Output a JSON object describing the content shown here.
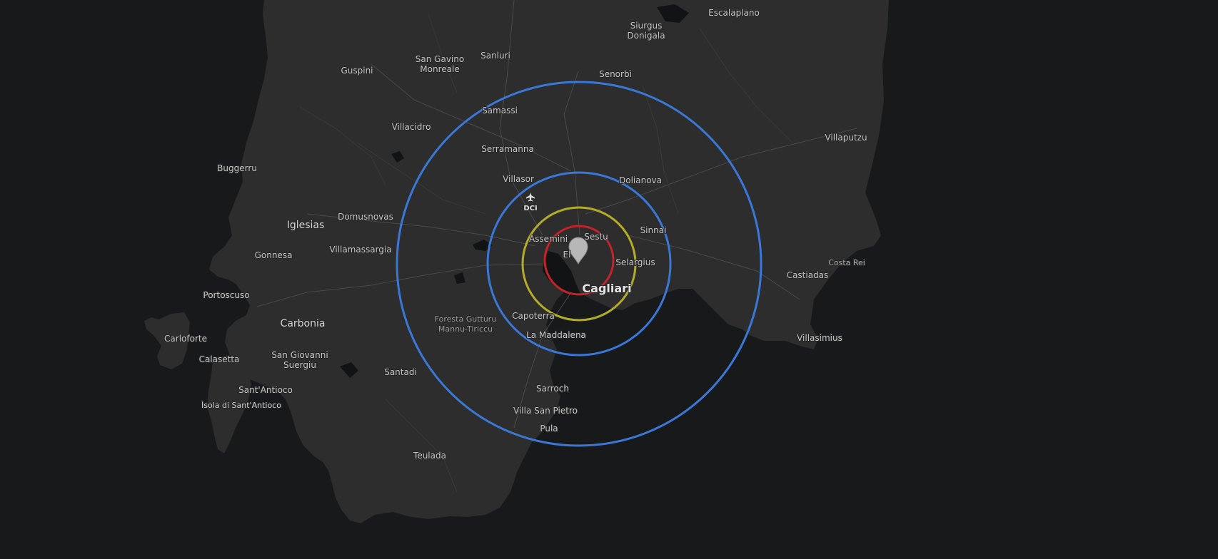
{
  "map": {
    "colors": {
      "background": "#17191a",
      "land": "#2d2d2d",
      "ring_blue": "#3a78d8",
      "ring_yellow": "#b3ad26",
      "ring_red": "#c42328",
      "marker": "#b7b7b7"
    },
    "marker_icon": "map-pin-icon",
    "airport_icon": "airplane-icon",
    "airport_code": "DCI",
    "labels": {
      "escalaplano": "Escalaplano",
      "siurgus_1": "Siurgus",
      "siurgus_2": "Donigala",
      "sangavino_1": "San Gavino",
      "sangavino_2": "Monreale",
      "sanluri": "Sanluri",
      "guspini": "Guspini",
      "senorbi": "Senorbì",
      "samassi": "Samassi",
      "villacidro": "Villacidro",
      "villaputzu": "Villaputzu",
      "serramanna": "Serramanna",
      "buggerru": "Buggerru",
      "villasor": "Villasor",
      "dolianova": "Dolianova",
      "domusnovas": "Domusnovas",
      "iglesias": "Iglesias",
      "sinnai": "Sinnai",
      "assemini": "Assemini",
      "sestu": "Sestu",
      "gonnesa": "Gonnesa",
      "villamassargia": "Villamassargia",
      "elmas": "El",
      "costarei": "Costa Rei",
      "selargius": "Selargius",
      "castiadas": "Castiadas",
      "cagliari": "Cagliari",
      "portoscuso": "Portoscuso",
      "capoterra": "Capoterra",
      "foresta_1": "Foresta Gutturu",
      "foresta_2": "Mannu-Tiriccu",
      "carbonia": "Carbonia",
      "carloforte": "Carloforte",
      "lamaddalena": "La Maddalena",
      "villasimius": "Villasimius",
      "calasetta": "Calasetta",
      "sangiovanni_1": "San Giovanni",
      "sangiovanni_2": "Suergiu",
      "santadi": "Santadi",
      "sarroch": "Sarroch",
      "santantioco": "Sant'Antioco",
      "isola": "Ìsola di Sant'Antioco",
      "villasanpietro": "Villa San Pietro",
      "pula": "Pula",
      "teulada": "Teulada"
    }
  }
}
